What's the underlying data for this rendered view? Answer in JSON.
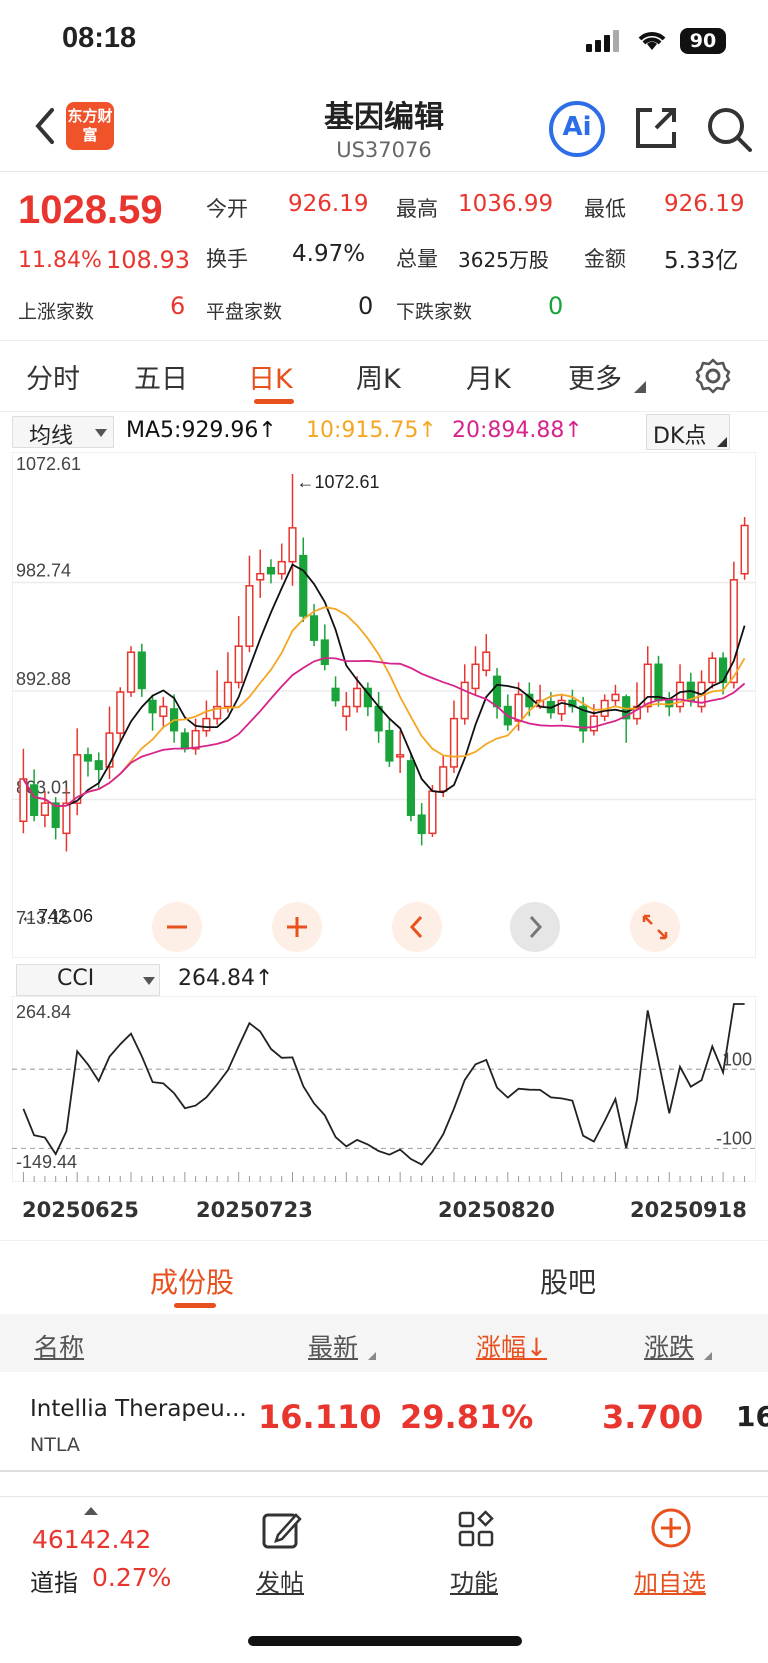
{
  "status_bar": {
    "time": "08:18",
    "battery": "90"
  },
  "header": {
    "logo_text": "东方财富",
    "title": "基因编辑",
    "subtitle": "US37076",
    "ai_label": "Ai"
  },
  "quote": {
    "price": "1028.59",
    "change_pct": "11.84%",
    "change_abs": "108.93",
    "open_label": "今开",
    "open": "926.19",
    "high_label": "最高",
    "high": "1036.99",
    "low_label": "最低",
    "low": "926.19",
    "turnover_label": "换手",
    "turnover": "4.97%",
    "volume_label": "总量",
    "volume": "3625万股",
    "amount_label": "金额",
    "amount": "5.33亿",
    "up_label": "上涨家数",
    "up": "6",
    "flat_label": "平盘家数",
    "flat": "0",
    "down_label": "下跌家数",
    "down": "0"
  },
  "chart_tabs": [
    {
      "label": "分时"
    },
    {
      "label": "五日"
    },
    {
      "label": "日K",
      "active": true
    },
    {
      "label": "周K"
    },
    {
      "label": "月K"
    },
    {
      "label": "更多"
    }
  ],
  "indicators": {
    "ma_select": "均线",
    "ma5": "MA5:929.96↑",
    "ma10": "10:915.75↑",
    "ma20": "20:894.88↑",
    "dk_button": "DK点",
    "cci_select": "CCI",
    "cci_value": "264.84↑"
  },
  "colors": {
    "up": "#e8352e",
    "down": "#1aa33b",
    "ma5": "#111111",
    "ma10": "#f5a623",
    "ma20": "#d6248c",
    "accent": "#e8501e"
  },
  "chart_data": [
    {
      "type": "candlestick",
      "y_axis_labels": [
        "1072.61",
        "982.74",
        "892.88",
        "803.01",
        "713.15"
      ],
      "ylim": [
        713.15,
        1072.61
      ],
      "annotations": [
        "←1072.61",
        "←742.06"
      ],
      "candles": [
        [
          785,
          820,
          845,
          775
        ],
        [
          815,
          790,
          828,
          785
        ],
        [
          790,
          800,
          810,
          780
        ],
        [
          800,
          780,
          805,
          770
        ],
        [
          775,
          800,
          812,
          760
        ],
        [
          800,
          840,
          862,
          790
        ],
        [
          840,
          835,
          846,
          822
        ],
        [
          835,
          828,
          842,
          812
        ],
        [
          830,
          858,
          880,
          820
        ],
        [
          858,
          892,
          896,
          850
        ],
        [
          892,
          925,
          930,
          888
        ],
        [
          925,
          895,
          932,
          888
        ],
        [
          885,
          875,
          890,
          860
        ],
        [
          872,
          880,
          888,
          862
        ],
        [
          878,
          860,
          890,
          850
        ],
        [
          858,
          845,
          862,
          842
        ],
        [
          845,
          860,
          870,
          840
        ],
        [
          860,
          870,
          885,
          855
        ],
        [
          870,
          880,
          910,
          865
        ],
        [
          880,
          900,
          925,
          875
        ],
        [
          900,
          930,
          955,
          895
        ],
        [
          930,
          980,
          1005,
          925
        ],
        [
          985,
          990,
          1010,
          970
        ],
        [
          995,
          990,
          1002,
          982
        ],
        [
          990,
          1000,
          1015,
          985
        ],
        [
          1000,
          1028,
          1072.61,
          980
        ],
        [
          1005,
          955,
          1020,
          950
        ],
        [
          955,
          935,
          965,
          930
        ],
        [
          935,
          915,
          948,
          910
        ],
        [
          895,
          885,
          905,
          880
        ],
        [
          872,
          880,
          892,
          860
        ],
        [
          880,
          895,
          905,
          875
        ],
        [
          895,
          880,
          900,
          872
        ],
        [
          880,
          860,
          892,
          850
        ],
        [
          860,
          835,
          870,
          830
        ],
        [
          840,
          840,
          860,
          825
        ],
        [
          835,
          790,
          842,
          785
        ],
        [
          790,
          775,
          800,
          765
        ],
        [
          775,
          810,
          815,
          772
        ],
        [
          810,
          830,
          840,
          805
        ],
        [
          830,
          870,
          885,
          825
        ],
        [
          870,
          900,
          915,
          865
        ],
        [
          895,
          915,
          930,
          890
        ],
        [
          910,
          925,
          940,
          905
        ],
        [
          905,
          880,
          912,
          870
        ],
        [
          880,
          865,
          890,
          860
        ],
        [
          868,
          890,
          900,
          860
        ],
        [
          890,
          880,
          900,
          872
        ],
        [
          880,
          885,
          898,
          878
        ],
        [
          884,
          875,
          892,
          870
        ],
        [
          874,
          885,
          890,
          868
        ],
        [
          885,
          880,
          894,
          875
        ],
        [
          880,
          860,
          888,
          850
        ],
        [
          860,
          872,
          882,
          856
        ],
        [
          872,
          885,
          890,
          868
        ],
        [
          885,
          890,
          898,
          880
        ],
        [
          888,
          870,
          890,
          850
        ],
        [
          870,
          880,
          900,
          865
        ],
        [
          880,
          915,
          930,
          875
        ],
        [
          915,
          885,
          922,
          880
        ],
        [
          885,
          880,
          892,
          872
        ],
        [
          880,
          900,
          915,
          875
        ],
        [
          900,
          885,
          908,
          880
        ],
        [
          880,
          900,
          910,
          875
        ],
        [
          900,
          920,
          925,
          895
        ],
        [
          920,
          900,
          925,
          890
        ],
        [
          900,
          985,
          1000,
          895
        ],
        [
          990,
          1030,
          1036.99,
          985
        ]
      ],
      "cci": {
        "ylim": [
          -149.44,
          264.84
        ],
        "y_axis_labels": [
          "264.84",
          "-149.44"
        ],
        "ref_labels": [
          "100",
          "-100"
        ]
      }
    }
  ],
  "x_dates": [
    "20250625",
    "20250723",
    "20250820",
    "20250918"
  ],
  "sections": [
    {
      "label": "成份股",
      "active": true
    },
    {
      "label": "股吧"
    }
  ],
  "table": {
    "headers": [
      "名称",
      "最新",
      "涨幅↓",
      "涨跌"
    ],
    "rows": [
      {
        "name": "Intellia Therapeu...",
        "code": "NTLA",
        "last": "16.110",
        "pct": "29.81%",
        "chg": "3.700",
        "extra": "16"
      }
    ]
  },
  "bottom_bar": {
    "index_value": "46142.42",
    "index_name": "道指",
    "index_pct": "0.27%",
    "post": "发帖",
    "func": "功能",
    "add": "加自选"
  }
}
